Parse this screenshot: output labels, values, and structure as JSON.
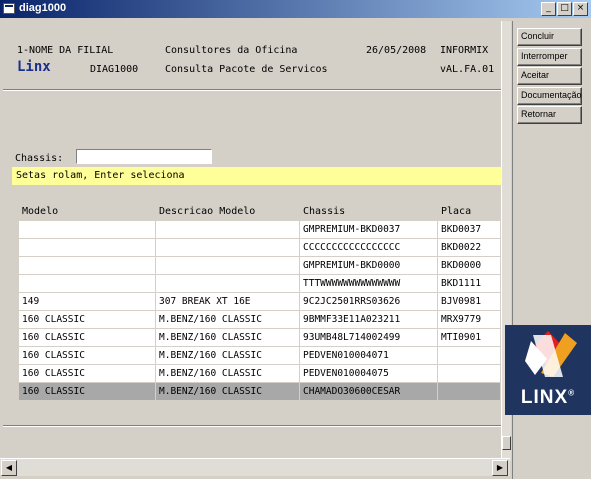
{
  "window": {
    "title": "diag1000",
    "min_glyph": "_",
    "max_glyph": "□",
    "close_glyph": "×"
  },
  "header": {
    "branch": "1-NOME DA FILIAL",
    "module": "Consultores da Oficina",
    "date": "26/05/2008",
    "system": "INFORMIX",
    "brand": "Linx",
    "program": "DIAG1000",
    "screen": "Consulta Pacote de Servicos",
    "version": "vAL.FA.01"
  },
  "search": {
    "label": "Chassis:",
    "value": ""
  },
  "hint": "Setas rolam, Enter seleciona",
  "table": {
    "columns": [
      "Modelo",
      "Descricao Modelo",
      "Chassis",
      "Placa"
    ],
    "rows": [
      [
        "",
        "",
        "GMPREMIUM-BKD0037",
        "BKD0037"
      ],
      [
        "",
        "",
        "CCCCCCCCCCCCCCCCC",
        "BKD0022"
      ],
      [
        "",
        "",
        "GMPREMIUM-BKD0000",
        "BKD0000"
      ],
      [
        "",
        "",
        "TTTWWWWWWWWWWWWWW",
        "BKD1111"
      ],
      [
        "149",
        "307 BREAK XT 16E",
        "9C2JC2501RRS03626",
        "BJV0981"
      ],
      [
        "160 CLASSIC",
        "M.BENZ/160 CLASSIC",
        "9BMMF33E11A023211",
        "MRX9779"
      ],
      [
        "160 CLASSIC",
        "M.BENZ/160 CLASSIC",
        "93UMB48L714002499",
        "MTI0901"
      ],
      [
        "160 CLASSIC",
        "M.BENZ/160 CLASSIC",
        "PEDVEN010004071",
        ""
      ],
      [
        "160 CLASSIC",
        "M.BENZ/160 CLASSIC",
        "PEDVEN010004075",
        ""
      ],
      [
        "160 CLASSIC",
        "M.BENZ/160 CLASSIC",
        "CHAMADO30600CESAR",
        ""
      ]
    ],
    "selected_row": 9
  },
  "actions": {
    "concluir": "Concluir",
    "interromper": "Interromper",
    "aceitar": "Aceitar",
    "documentacao": "Documentação",
    "retornar": "Retornar"
  },
  "logo": {
    "text": "LINX",
    "registered": "®"
  },
  "colors": {
    "hint_bg": "#ffff99",
    "brand_blue": "#1c2f8a",
    "logo_bg": "#1f3560",
    "selected_row": "#a8a8a8"
  }
}
